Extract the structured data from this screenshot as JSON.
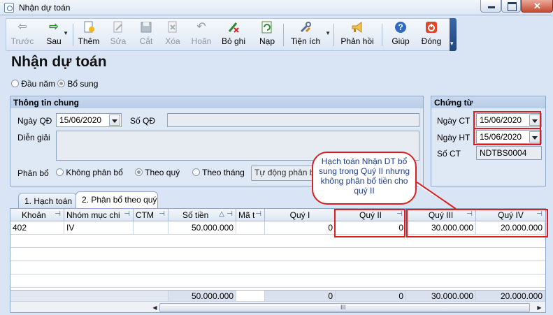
{
  "window": {
    "title": "Nhận dự toán"
  },
  "toolbar": {
    "back": "Trước",
    "next": "Sau",
    "add": "Thêm",
    "edit": "Sửa",
    "cut": "Cắt",
    "delete": "Xóa",
    "undo": "Hoãn",
    "record": "Bỏ ghi",
    "load": "Nạp",
    "utilities": "Tiện ích",
    "feedback": "Phản hồi",
    "help": "Giúp",
    "close": "Đóng"
  },
  "page": {
    "title": "Nhận dự toán"
  },
  "options": {
    "start_year": "Đầu năm",
    "supplement": "Bổ sung"
  },
  "general": {
    "title": "Thông tin chung",
    "decision_date_label": "Ngày QĐ",
    "decision_date": "15/06/2020",
    "decision_no_label": "Số QĐ",
    "decision_no": "",
    "description_label": "Diễn giải",
    "description": "",
    "allocation_label": "Phân bổ",
    "alloc_none": "Không phân bổ",
    "alloc_quarter": "Theo quý",
    "alloc_month": "Theo tháng",
    "auto_alloc": "Tự động phân bổ"
  },
  "voucher": {
    "title": "Chứng từ",
    "ct_date_label": "Ngày CT",
    "ct_date": "15/06/2020",
    "ht_date_label": "Ngày HT",
    "ht_date": "15/06/2020",
    "ct_no_label": "Số CT",
    "ct_no": "NDTBS0004"
  },
  "tabs": [
    {
      "label": "1. Hạch toán"
    },
    {
      "label": "2. Phân bổ theo quý"
    }
  ],
  "grid": {
    "headers": [
      "Khoản",
      "Nhóm mục chi",
      "CTM",
      "Số tiền",
      "Mã t",
      "Quý I",
      "Quý II",
      "Quý III",
      "Quý IV"
    ],
    "rows": [
      [
        "402",
        "IV",
        "",
        "50.000.000",
        "",
        "0",
        "0",
        "30.000.000",
        "20.000.000"
      ]
    ],
    "totals": {
      "amount": "50.000.000",
      "q1": "0",
      "q2": "0",
      "q3": "30.000.000",
      "q4": "20.000.000"
    },
    "scroll_grip": "III"
  },
  "annotation": {
    "text": "Hạch toán Nhận DT bổ sung trong Quý II nhưng không phân bổ tiền cho quý II"
  },
  "colors": {
    "highlight": "#e11b1b",
    "callout_text": "#1d3d8f",
    "toolbar_accent": "#1f4680"
  }
}
